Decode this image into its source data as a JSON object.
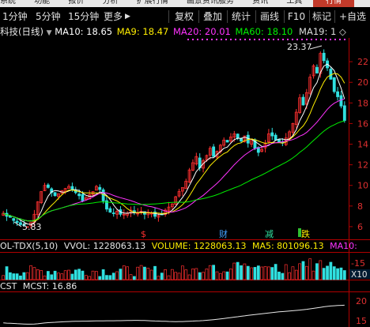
{
  "menu": {
    "items": [
      "系统",
      "功能",
      "报价",
      "分析",
      "扩展行情",
      "画景资讯服务",
      "资讯",
      "工具"
    ],
    "right_button": "行情"
  },
  "toolbar": {
    "period_tabs": [
      "1分钟",
      "5分钟",
      "15分钟",
      "更多"
    ],
    "more_arrow": "▶",
    "buttons": [
      "复权",
      "叠加",
      "统计",
      "画线",
      "F10",
      "标记",
      "+自选"
    ]
  },
  "main_header": {
    "title": "科技(日线)",
    "ma10": "MA10: 18.65",
    "ma9": "MA9: 18.47",
    "ma20": "MA20: 20.01",
    "ma60": "MA60: 18.10",
    "ma19": "MA19: 1",
    "ma19_icon": "◇"
  },
  "price_axis": [
    "22",
    "20",
    "18",
    "16",
    "14",
    "12",
    "10",
    "8",
    "6"
  ],
  "annotations": {
    "high": "23.37",
    "low": "5.83",
    "event_s": "$",
    "event_cai": "财",
    "event_jian": "减",
    "event_die": "跌"
  },
  "volume_header": {
    "title": "OL-TDX(5,10)",
    "vvol": "VVOL: 1228063.13",
    "volume": "VOLUME: 1228063.13",
    "ma5": "MA5: 801096.13",
    "ma10": "MA10:"
  },
  "volume_axis": {
    "top": "-15",
    "unit": "X10"
  },
  "mcst_header": {
    "title": "CST",
    "mcst": "MCST: 16.86"
  },
  "mcst_axis": [
    "20",
    "15"
  ],
  "colors": {
    "up": "#ff3030",
    "down": "#30e0e0",
    "ma_white": "#ffffff",
    "ma_yellow": "#ffee00",
    "ma_magenta": "#ff33ff",
    "ma_green": "#00ee00",
    "axis": "#b00000"
  },
  "chart_data": {
    "type": "candlestick",
    "title": "科技(日线)",
    "price_axis_range": [
      5,
      24
    ],
    "series_lines": [
      {
        "name": "MA10",
        "value": 18.65
      },
      {
        "name": "MA9",
        "value": 18.47
      },
      {
        "name": "MA20",
        "value": 20.01
      },
      {
        "name": "MA60",
        "value": 18.1
      }
    ],
    "closes": [
      7.3,
      7.0,
      6.9,
      6.6,
      6.4,
      6.2,
      6.1,
      6.0,
      6.4,
      7.2,
      8.4,
      9.4,
      10.0,
      9.8,
      9.3,
      9.0,
      9.2,
      9.5,
      9.7,
      9.9,
      9.6,
      9.3,
      9.0,
      8.5,
      8.8,
      9.1,
      9.4,
      9.9,
      9.6,
      8.5,
      7.7,
      7.4,
      7.3,
      7.5,
      7.2,
      7.2,
      7.3,
      7.6,
      7.4,
      7.3,
      7.5,
      7.2,
      7.4,
      7.3,
      7.0,
      7.1,
      7.2,
      7.6,
      7.9,
      8.2,
      8.9,
      9.4,
      9.8,
      10.4,
      11.5,
      12.2,
      12.8,
      11.7,
      12.4,
      12.9,
      13.6,
      12.8,
      13.3,
      13.9,
      14.4,
      14.2,
      14.7,
      15.0,
      14.6,
      14.3,
      14.8,
      14.1,
      14.5,
      13.6,
      13.2,
      13.5,
      14.1,
      15.0,
      14.8,
      14.4,
      14.2,
      14.1,
      14.6,
      15.2,
      16.0,
      17.1,
      18.5,
      17.8,
      19.0,
      20.5,
      21.6,
      20.9,
      22.8,
      22.1,
      21.4,
      20.3,
      19.1,
      18.6,
      17.7,
      16.3
    ],
    "high": 23.37,
    "low": 5.83
  }
}
